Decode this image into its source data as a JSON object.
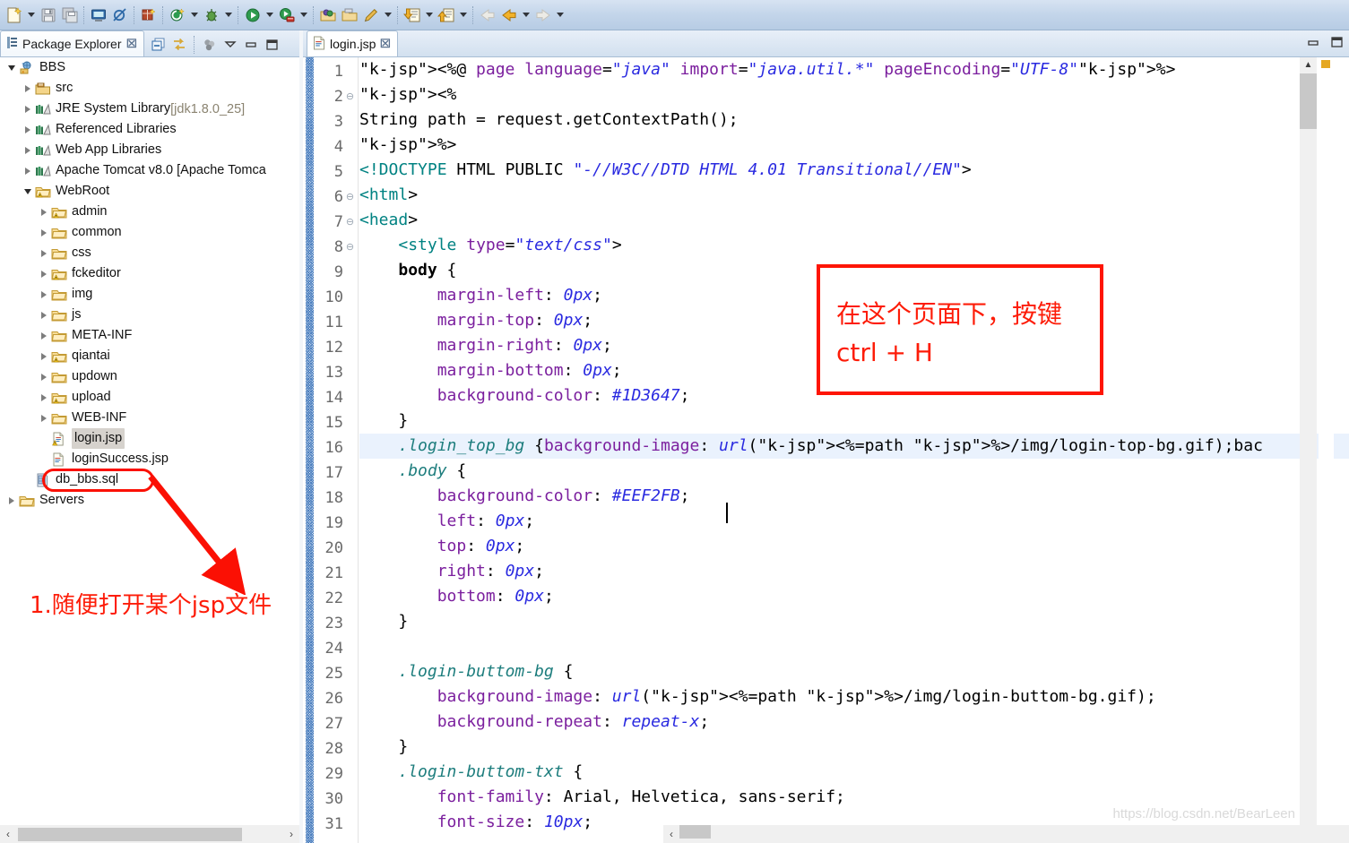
{
  "toolbar": {
    "items": [
      {
        "name": "new-wizard-icon",
        "arrow": true
      },
      {
        "name": "save-icon",
        "arrow": false
      },
      {
        "name": "save-all-icon",
        "arrow": false
      },
      {
        "name": "print-icon",
        "arrow": false
      },
      {
        "name": "toggle-breakpoint-icon",
        "arrow": false
      },
      {
        "name": "new-java-package-icon",
        "arrow": false
      },
      {
        "name": "new-java-class-icon",
        "arrow": true
      },
      {
        "name": "debug-icon",
        "arrow": true
      },
      {
        "name": "run-icon",
        "arrow": true
      },
      {
        "name": "run-server-icon",
        "arrow": true
      },
      {
        "name": "open-type-icon",
        "arrow": false
      },
      {
        "name": "open-resource-icon",
        "arrow": false
      },
      {
        "name": "search-pencil-icon",
        "arrow": true
      },
      {
        "name": "next-annotation-icon",
        "arrow": true
      },
      {
        "name": "previous-annotation-icon",
        "arrow": true
      },
      {
        "name": "back-history-icon",
        "arrow": false
      },
      {
        "name": "backward-icon",
        "arrow": true
      },
      {
        "name": "forward-icon",
        "arrow": true
      }
    ]
  },
  "package_explorer": {
    "tab_title": "Package Explorer",
    "tab_close": "☒",
    "tools": [
      "collapse-all-icon",
      "link-with-editor-icon",
      "view-menu-dots-icon",
      "view-menu-icon",
      "minimize-icon",
      "maximize-icon"
    ],
    "tree": [
      {
        "label": "BBS",
        "indent": 0,
        "twist": "expanded",
        "icon": "java-web-project-icon",
        "dim": ""
      },
      {
        "label": "src",
        "indent": 1,
        "twist": "collapsed",
        "icon": "source-folder-icon",
        "dim": ""
      },
      {
        "label": "JRE System Library",
        "indent": 1,
        "twist": "collapsed",
        "icon": "library-icon",
        "dim": "[jdk1.8.0_25]"
      },
      {
        "label": "Referenced Libraries",
        "indent": 1,
        "twist": "collapsed",
        "icon": "library-icon",
        "dim": ""
      },
      {
        "label": "Web App Libraries",
        "indent": 1,
        "twist": "collapsed",
        "icon": "library-icon",
        "dim": ""
      },
      {
        "label": "Apache Tomcat v8.0 [Apache Tomca",
        "indent": 1,
        "twist": "collapsed",
        "icon": "library-icon",
        "dim": ""
      },
      {
        "label": "WebRoot",
        "indent": 1,
        "twist": "expanded",
        "icon": "folder-warn-icon",
        "dim": ""
      },
      {
        "label": "admin",
        "indent": 2,
        "twist": "collapsed",
        "icon": "folder-warn-icon",
        "dim": ""
      },
      {
        "label": "common",
        "indent": 2,
        "twist": "collapsed",
        "icon": "folder-icon",
        "dim": ""
      },
      {
        "label": "css",
        "indent": 2,
        "twist": "collapsed",
        "icon": "folder-icon",
        "dim": ""
      },
      {
        "label": "fckeditor",
        "indent": 2,
        "twist": "collapsed",
        "icon": "folder-warn-icon",
        "dim": ""
      },
      {
        "label": "img",
        "indent": 2,
        "twist": "collapsed",
        "icon": "folder-icon",
        "dim": ""
      },
      {
        "label": "js",
        "indent": 2,
        "twist": "collapsed",
        "icon": "folder-icon",
        "dim": ""
      },
      {
        "label": "META-INF",
        "indent": 2,
        "twist": "collapsed",
        "icon": "folder-icon",
        "dim": ""
      },
      {
        "label": "qiantai",
        "indent": 2,
        "twist": "collapsed",
        "icon": "folder-warn-icon",
        "dim": ""
      },
      {
        "label": "updown",
        "indent": 2,
        "twist": "collapsed",
        "icon": "folder-icon",
        "dim": ""
      },
      {
        "label": "upload",
        "indent": 2,
        "twist": "collapsed",
        "icon": "folder-warn-icon",
        "dim": ""
      },
      {
        "label": "WEB-INF",
        "indent": 2,
        "twist": "collapsed",
        "icon": "folder-icon",
        "dim": ""
      },
      {
        "label": "login.jsp",
        "indent": 2,
        "twist": "none",
        "icon": "jsp-file-warn-icon",
        "dim": "",
        "selected": true
      },
      {
        "label": "loginSuccess.jsp",
        "indent": 2,
        "twist": "none",
        "icon": "jsp-file-icon",
        "dim": ""
      },
      {
        "label": "db_bbs.sql",
        "indent": 1,
        "twist": "none",
        "icon": "sql-file-icon",
        "dim": ""
      },
      {
        "label": "Servers",
        "indent": 0,
        "twist": "collapsed",
        "icon": "folder-icon",
        "dim": ""
      }
    ]
  },
  "editor": {
    "tab_title": "login.jsp",
    "tab_close": "☒",
    "tools": [
      "minimize-icon",
      "maximize-icon"
    ],
    "lines": [
      {
        "n": 1,
        "fold": "",
        "indent": 0
      },
      {
        "n": 2,
        "fold": "⊖",
        "indent": 0
      },
      {
        "n": 3,
        "fold": "",
        "indent": 0
      },
      {
        "n": 4,
        "fold": "",
        "indent": 0
      },
      {
        "n": 5,
        "fold": "",
        "indent": 0
      },
      {
        "n": 6,
        "fold": "⊖",
        "indent": 0
      },
      {
        "n": 7,
        "fold": "⊖",
        "indent": 0
      },
      {
        "n": 8,
        "fold": "⊖",
        "indent": 0
      },
      {
        "n": 9,
        "fold": "",
        "indent": 0
      },
      {
        "n": 10,
        "fold": "",
        "indent": 0
      },
      {
        "n": 11,
        "fold": "",
        "indent": 0
      },
      {
        "n": 12,
        "fold": "",
        "indent": 0
      },
      {
        "n": 13,
        "fold": "",
        "indent": 0
      },
      {
        "n": 14,
        "fold": "",
        "indent": 0
      },
      {
        "n": 15,
        "fold": "",
        "indent": 0
      },
      {
        "n": 16,
        "fold": "",
        "indent": 0
      },
      {
        "n": 17,
        "fold": "",
        "indent": 0
      },
      {
        "n": 18,
        "fold": "",
        "indent": 0
      },
      {
        "n": 19,
        "fold": "",
        "indent": 0
      },
      {
        "n": 20,
        "fold": "",
        "indent": 0
      },
      {
        "n": 21,
        "fold": "",
        "indent": 0
      },
      {
        "n": 22,
        "fold": "",
        "indent": 0
      },
      {
        "n": 23,
        "fold": "",
        "indent": 0
      },
      {
        "n": 24,
        "fold": "",
        "indent": 0
      },
      {
        "n": 25,
        "fold": "",
        "indent": 0
      },
      {
        "n": 26,
        "fold": "",
        "indent": 0
      },
      {
        "n": 27,
        "fold": "",
        "indent": 0
      },
      {
        "n": 28,
        "fold": "",
        "indent": 0
      },
      {
        "n": 29,
        "fold": "",
        "indent": 0
      },
      {
        "n": 30,
        "fold": "",
        "indent": 0
      },
      {
        "n": 31,
        "fold": "",
        "indent": 0
      }
    ],
    "code_text": [
      "<%@ page language=\"java\" import=\"java.util.*\" pageEncoding=\"UTF-8\"%>",
      "<%",
      "String path = request.getContextPath();",
      "%>",
      "<!DOCTYPE HTML PUBLIC \"-//W3C//DTD HTML 4.01 Transitional//EN\">",
      "<html>",
      "<head>",
      "    <style type=\"text/css\">",
      "    body {",
      "        margin-left: 0px;",
      "        margin-top: 0px;",
      "        margin-right: 0px;",
      "        margin-bottom: 0px;",
      "        background-color: #1D3647;",
      "    }",
      "    .login_top_bg {background-image: url(<%=path %>/img/login-top-bg.gif);bac",
      "    .body {",
      "        background-color: #EEF2FB;",
      "        left: 0px;",
      "        top: 0px;",
      "        right: 0px;",
      "        bottom: 0px;",
      "    }",
      "",
      "    .login-buttom-bg {",
      "        background-image: url(<%=path %>/img/login-buttom-bg.gif);",
      "        background-repeat: repeat-x;",
      "    }",
      "    .login-buttom-txt {",
      "        font-family: Arial, Helvetica, sans-serif;",
      "        font-size: 10px;"
    ],
    "highlighted_line": 16,
    "watermark": "https://blog.csdn.net/BearLeen"
  },
  "annotations": {
    "box_line1": "在这个页面下，按键",
    "box_line2": "ctrl + H",
    "left_note": "1.随便打开某个jsp文件",
    "red_color": "#fe1505"
  }
}
